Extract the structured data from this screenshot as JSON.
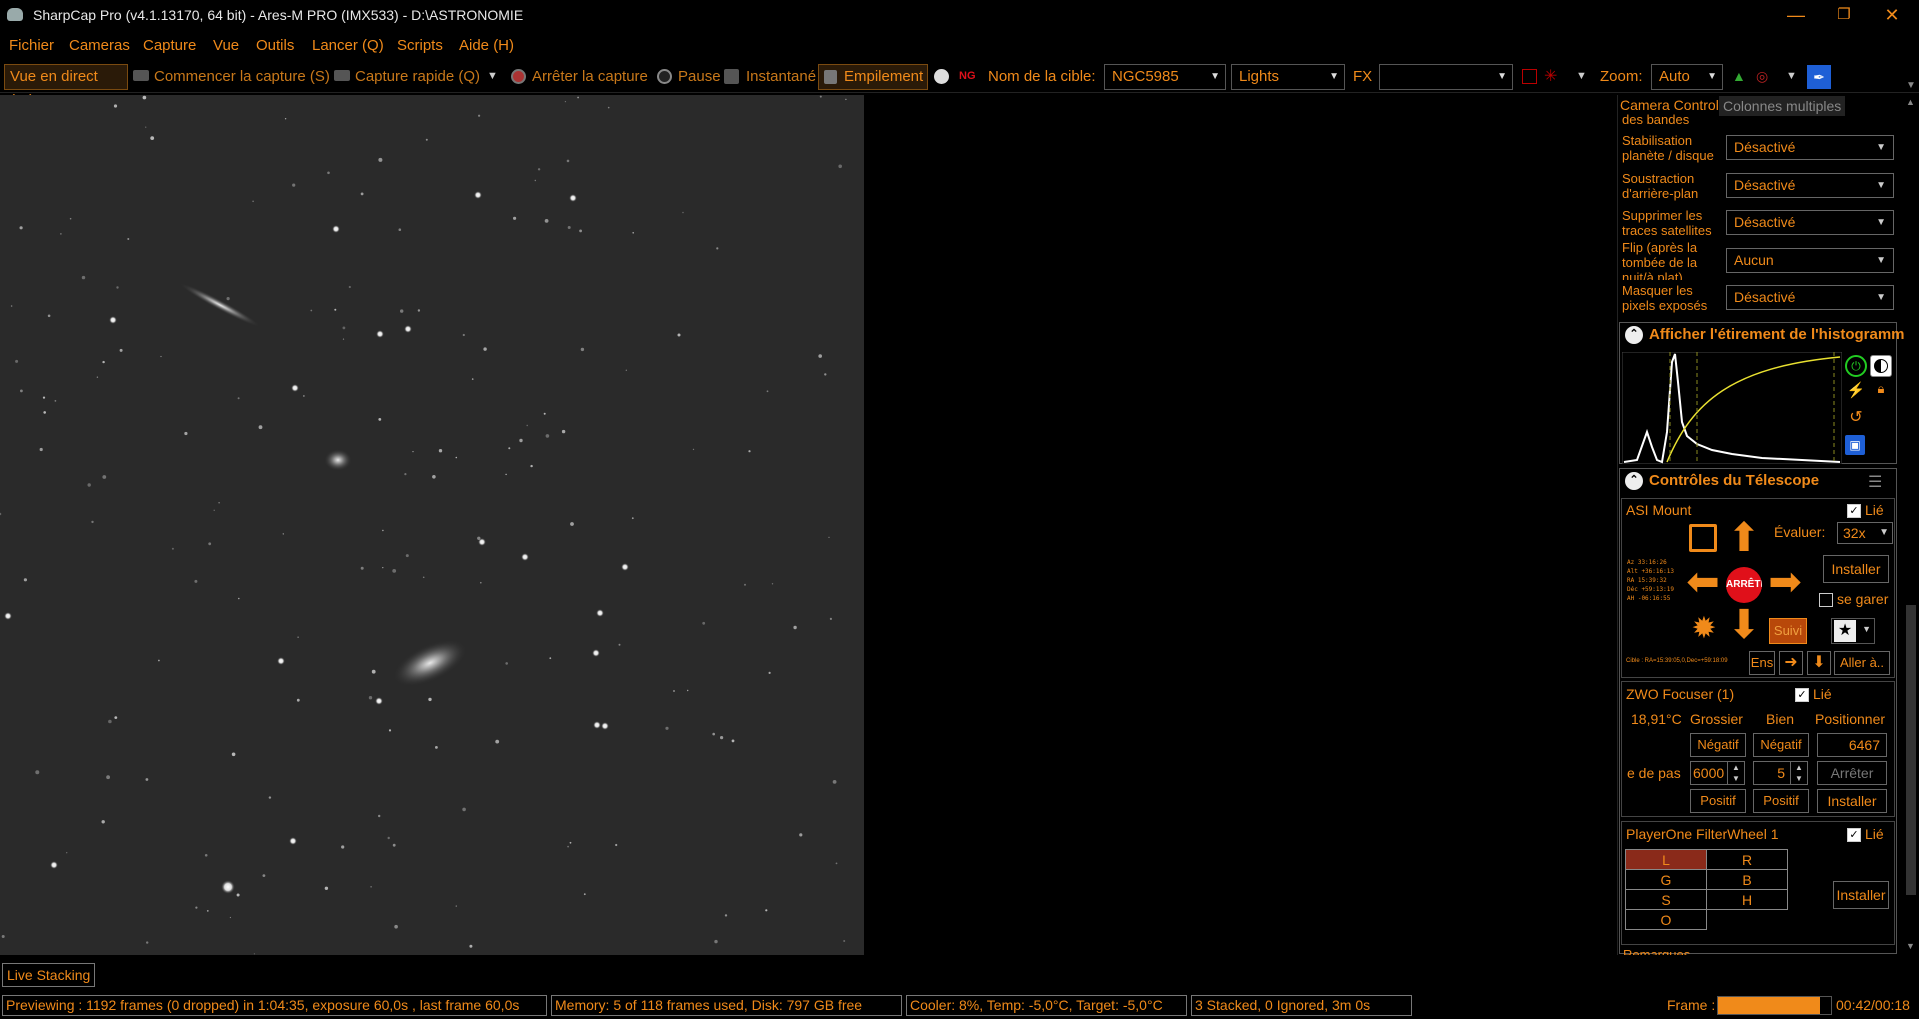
{
  "window": {
    "title": "SharpCap Pro (v4.1.13170, 64 bit) - Ares-M PRO (IMX533) - D:\\ASTRONOMIE"
  },
  "menu": [
    "Fichier",
    "Cameras",
    "Capture",
    "Vue",
    "Outils",
    "Lancer (Q)",
    "Scripts",
    "Aide (H)"
  ],
  "toolbar": {
    "live": "Vue en direct (W)",
    "start_capture": "Commencer la capture (S)",
    "quick_capture": "Capture rapide (Q)",
    "stop_capture": "Arrêter la capture",
    "pause": "Pause",
    "snapshot": "Instantané",
    "stacking": "Empilement",
    "target_label": "Nom de la cible:",
    "target_value": "NGC5985",
    "frame_type": "Lights",
    "fx_label": "FX",
    "fx_value": "",
    "zoom_label": "Zoom:",
    "zoom_value": "Auto"
  },
  "panel": {
    "tab_camera": "Camera Controls",
    "tab_multi": "Colonnes multiples",
    "partial_label": "des bandes",
    "rows": [
      {
        "label": "Stabilisation planète / disque",
        "value": "Désactivé"
      },
      {
        "label": "Soustraction d'arrière-plan",
        "value": "Désactivé"
      },
      {
        "label": "Supprimer les traces satellites",
        "value": "Désactivé"
      },
      {
        "label": "Flip (après la tombée de la nuit/à plat)",
        "value": "Aucun"
      },
      {
        "label": "Masquer les pixels exposés",
        "value": "Désactivé"
      }
    ],
    "histogram_title": "Afficher l'étirement de l'histogramm",
    "telescope_title": "Contrôles du Télescope",
    "mount": {
      "name": "ASI Mount",
      "linked": "Lié",
      "rate_label": "Évaluer:",
      "rate_value": "32x",
      "install": "Installer",
      "park": "se garer",
      "stop": "ARRÊTE",
      "track": "Suivi",
      "ens": "Ens",
      "goto": "Aller à..",
      "coords": [
        "Az    33:16:26",
        "Alt  +36:16:13",
        "RA    15:39:32",
        "Déc  +59:13:19",
        "AH   -06:16:55"
      ],
      "target_line": "Cible : RA=15:39:05,0,Dec=+59:18:09"
    },
    "focuser": {
      "name": "ZWO Focuser (1)",
      "linked": "Lié",
      "temp": "18,91°C",
      "coarse": "Grossier",
      "fine": "Bien",
      "position": "Positionner",
      "neg": "Négatif",
      "pos": "Positif",
      "step_label": "e de pas",
      "coarse_step": "6000",
      "fine_step": "5",
      "pos_value": "6467",
      "stop": "Arrêter",
      "install": "Installer"
    },
    "filterwheel": {
      "name": "PlayerOne FilterWheel 1",
      "linked": "Lié",
      "filters": [
        "L",
        "R",
        "G",
        "B",
        "S",
        "H",
        "O"
      ],
      "install": "Installer"
    },
    "remarks": "Remarques"
  },
  "live_stacking": "Live Stacking",
  "status": {
    "preview": "Previewing : 1192 frames (0 dropped) in 1:04:35, exposure 60,0s , last frame 60,0s",
    "memory": "Memory: 5 of 118 frames used, Disk: 797 GB free",
    "cooler": "Cooler: 8%, Temp: -5,0°C, Target: -5,0°C",
    "stacked": "3 Stacked, 0 Ignored, 3m 0s",
    "frame_label": "Frame :",
    "frame_progress": 0.9,
    "frame_time": "00:42/00:18"
  },
  "colors": {
    "accent": "#f08a1a",
    "background": "#000000",
    "stop_red": "#e0101a"
  }
}
